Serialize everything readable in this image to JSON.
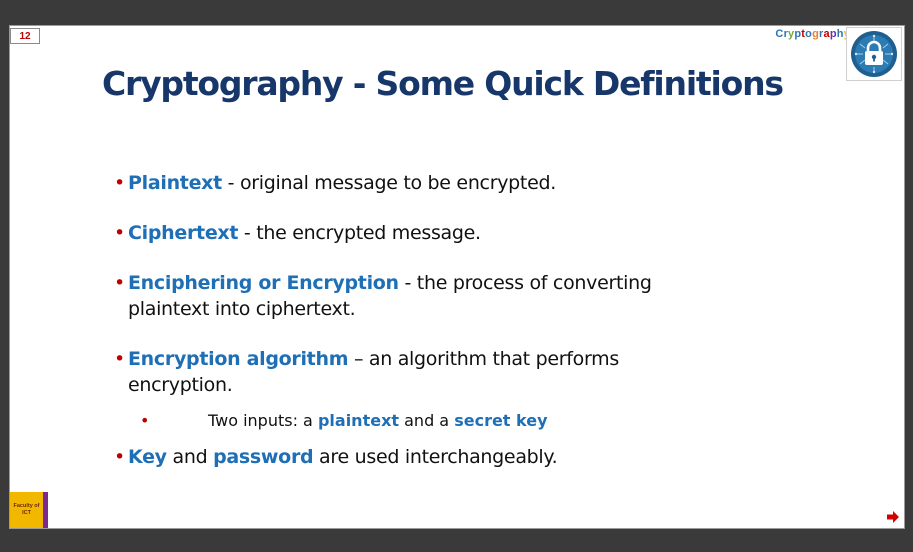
{
  "slide": {
    "number": "12",
    "brand_letters": [
      {
        "ch": "C",
        "color": "#2e75b6"
      },
      {
        "ch": "r",
        "color": "#2e75b6"
      },
      {
        "ch": "y",
        "color": "#70ad47"
      },
      {
        "ch": "p",
        "color": "#2e75b6"
      },
      {
        "ch": "t",
        "color": "#c00000"
      },
      {
        "ch": "o",
        "color": "#2e75b6"
      },
      {
        "ch": "g",
        "color": "#ed7d31"
      },
      {
        "ch": "r",
        "color": "#2e75b6"
      },
      {
        "ch": "a",
        "color": "#c00000"
      },
      {
        "ch": "p",
        "color": "#7030a0"
      },
      {
        "ch": "h",
        "color": "#2e75b6"
      },
      {
        "ch": "y",
        "color": "#ffc000"
      }
    ],
    "title": "Cryptography - Some Quick Definitions",
    "faculty_logo_text": "Faculty of ICT"
  },
  "definitions": {
    "b1": {
      "term": "Plaintext",
      "text": " - original message to be encrypted."
    },
    "b2": {
      "term": "Ciphertext",
      "text": " - the encrypted message."
    },
    "b3": {
      "term": "Enciphering or Encryption",
      "text": " - the process of converting plaintext into ciphertext."
    },
    "b4": {
      "term": "Encryption algorithm",
      "text": " – an algorithm that performs encryption."
    },
    "sub": {
      "prefix": "Two inputs: a ",
      "term1": "plaintext",
      "mid": " and a ",
      "term2": "secret key"
    },
    "b5": {
      "term1": "Key",
      "mid": " and ",
      "term2": "password",
      "text": " are used interchangeably."
    }
  },
  "colors": {
    "title": "#17376b",
    "term": "#1f6fb6",
    "bullet": "#c00000"
  },
  "icons": {
    "logo": "padlock-circuit-icon",
    "nav": "next-arrow-icon"
  }
}
